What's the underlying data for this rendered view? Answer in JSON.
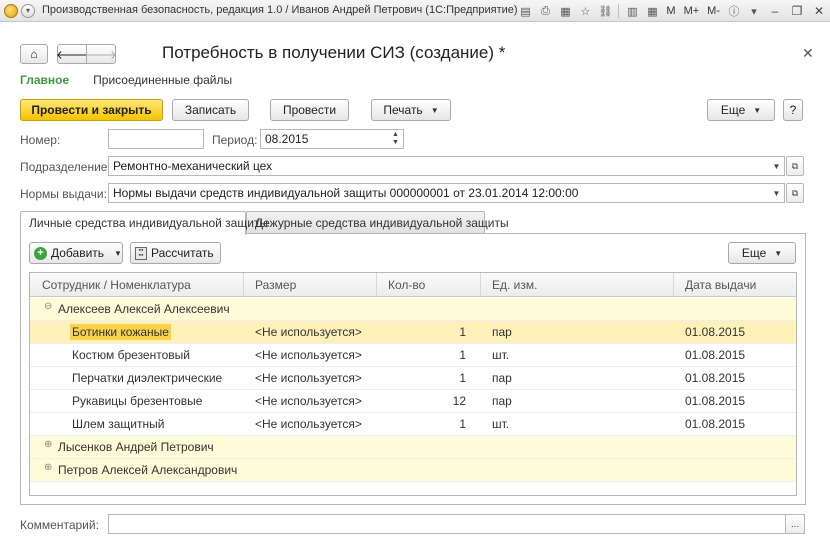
{
  "window": {
    "title": "Производственная безопасность, редакция 1.0 / Иванов Андрей Петрович  (1С:Предприятие)",
    "toolbar_text": {
      "m": "M",
      "mplus": "M+",
      "mminus": "M-"
    }
  },
  "header": {
    "title": "Потребность в получении СИЗ (создание) *",
    "tabs": [
      {
        "label": "Главное"
      },
      {
        "label": "Присоединенные файлы"
      }
    ]
  },
  "commands": {
    "post_close": "Провести и закрыть",
    "save": "Записать",
    "post": "Провести",
    "print": "Печать",
    "more": "Еще",
    "help": "?"
  },
  "form": {
    "number_label": "Номер:",
    "number_value": "",
    "period_label": "Период:",
    "period_value": "08.2015",
    "department_label": "Подразделение:",
    "department_value": "Ремонтно-механический цех",
    "norms_label": "Нормы выдачи:",
    "norms_value": "Нормы выдачи средств индивидуальной защиты 000000001 от 23.01.2014 12:00:00",
    "comment_label": "Комментарий:",
    "comment_value": ""
  },
  "inner_tabs": [
    {
      "label": "Личные средства индивидуальной защиты"
    },
    {
      "label": "Дежурные средства индивидуальной защиты"
    }
  ],
  "table_toolbar": {
    "add": "Добавить",
    "calculate": "Рассчитать",
    "more": "Еще"
  },
  "table": {
    "columns": [
      "Сотрудник / Номенклатура",
      "Размер",
      "Кол-во",
      "Ед. изм.",
      "Дата выдачи"
    ],
    "groups": [
      {
        "name": "Алексеев Алексей Алексеевич",
        "expanded": true,
        "items": [
          {
            "item": "Ботинки кожаные",
            "size": "<Не используется>",
            "qty": "1",
            "unit": "пар",
            "date": "01.08.2015"
          },
          {
            "item": "Костюм брезентовый",
            "size": "<Не используется>",
            "qty": "1",
            "unit": "шт.",
            "date": "01.08.2015"
          },
          {
            "item": "Перчатки диэлектрические",
            "size": "<Не используется>",
            "qty": "1",
            "unit": "пар",
            "date": "01.08.2015"
          },
          {
            "item": "Рукавицы брезентовые",
            "size": "<Не используется>",
            "qty": "12",
            "unit": "пар",
            "date": "01.08.2015"
          },
          {
            "item": "Шлем защитный",
            "size": "<Не используется>",
            "qty": "1",
            "unit": "шт.",
            "date": "01.08.2015"
          }
        ]
      },
      {
        "name": "Лысенков Андрей Петрович",
        "expanded": false,
        "items": []
      },
      {
        "name": "Петров Алексей Александрович",
        "expanded": false,
        "items": []
      }
    ]
  },
  "icons": {
    "home": "home-icon",
    "back": "arrow-left-icon",
    "forward": "arrow-right-icon",
    "close": "close-icon",
    "add": "plus-circle-icon",
    "calc": "calculator-icon"
  }
}
